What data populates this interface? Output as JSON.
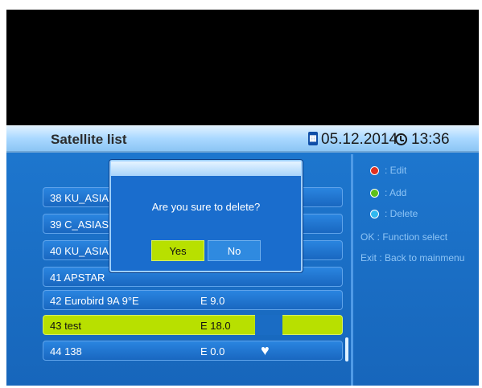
{
  "header": {
    "title": "Satellite list",
    "date": "05.12.2014",
    "time": "13:36"
  },
  "list": {
    "rows": [
      {
        "label": "38  KU_ASIA",
        "position": ""
      },
      {
        "label": "39  C_ASIAS",
        "position": ""
      },
      {
        "label": "40  KU_ASIA",
        "position": ""
      },
      {
        "label": "41  APSTAR",
        "position": ""
      },
      {
        "label": "42  Eurobird 9A 9°E",
        "position": "E 9.0"
      },
      {
        "label": "43  test",
        "position": "E 18.0"
      },
      {
        "label": "44  138",
        "position": "E 0.0"
      }
    ],
    "selected_index": 5
  },
  "dialog": {
    "message": "Are you sure to delete?",
    "yes_label": "Yes",
    "no_label": "No"
  },
  "help": {
    "edit": ": Edit",
    "add": ": Add",
    "delete": ": Delete",
    "ok": "OK   : Function select",
    "exit": "Exit  : Back to mainmenu"
  },
  "colors": {
    "red_key": "#e03020",
    "green_key": "#5ec01a",
    "blue_key": "#30b8f0",
    "highlight": "#b8e000",
    "background": "#1e78d0"
  },
  "icons": {
    "date": "calendar-icon",
    "time": "clock-icon",
    "favorite": "heart-icon"
  }
}
